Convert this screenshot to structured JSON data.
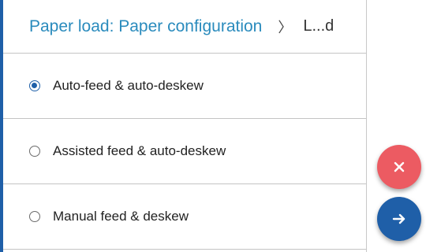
{
  "header": {
    "title": "Paper load: Paper configuration",
    "separator": "〉",
    "current": "L...d"
  },
  "options": [
    {
      "label": "Auto-feed & auto-deskew",
      "selected": true
    },
    {
      "label": "Assisted feed & auto-deskew",
      "selected": false
    },
    {
      "label": "Manual feed & deskew",
      "selected": false
    }
  ],
  "actions": {
    "cancel_icon": "close-icon",
    "cancel_color": "#ec5b62",
    "next_icon": "arrow-right-icon",
    "next_color": "#1f5fa8"
  },
  "colors": {
    "accent": "#1f5fa8",
    "title": "#2a8bbd"
  }
}
